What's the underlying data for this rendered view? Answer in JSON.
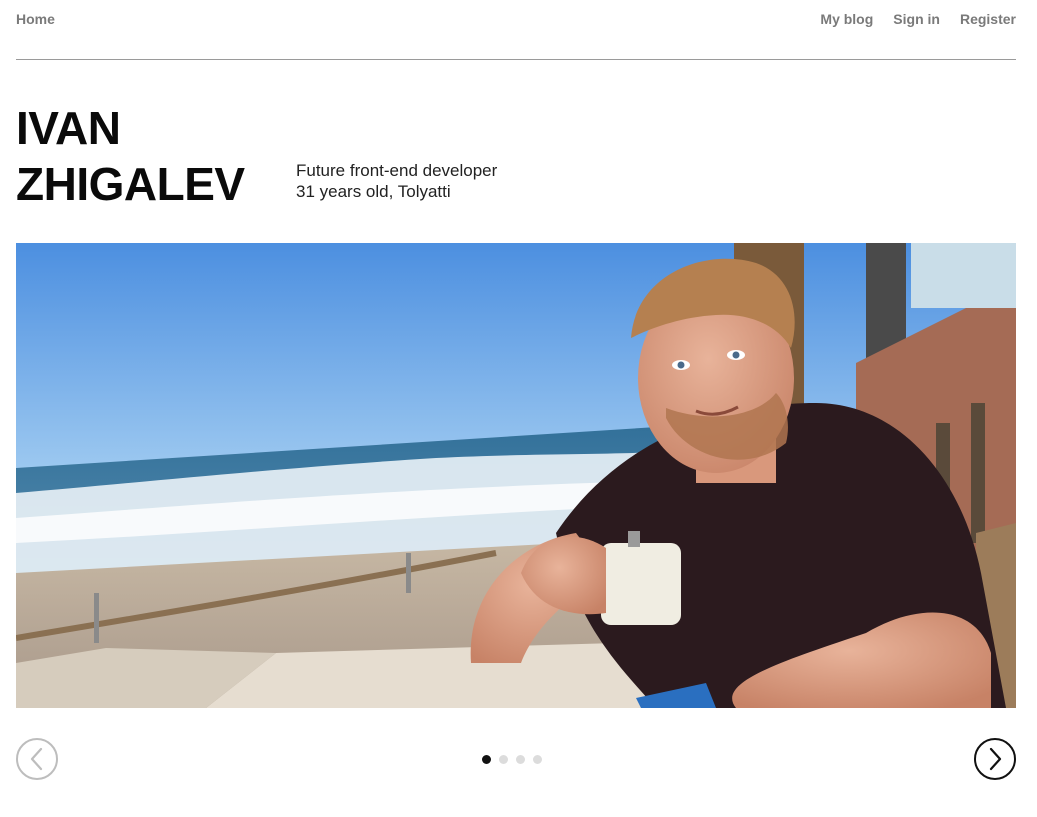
{
  "nav": {
    "home": "Home",
    "links": [
      "My blog",
      "Sign in",
      "Register"
    ]
  },
  "hero": {
    "name_line1": "IVAN",
    "name_line2": "ZHIGALEV",
    "tagline_line1": "Future front-end developer",
    "tagline_line2": "31 years old, Tolyatti"
  },
  "slider": {
    "total_slides": 4,
    "active_slide": 1
  },
  "colors": {
    "text": "#0a0a0a",
    "nav_text": "#7a7a7a",
    "divider": "#9a9a9a",
    "dot_active": "#111111",
    "dot_inactive": "#dcdcdc",
    "prev_arrow": "#bdbdbd",
    "next_arrow": "#111111"
  }
}
